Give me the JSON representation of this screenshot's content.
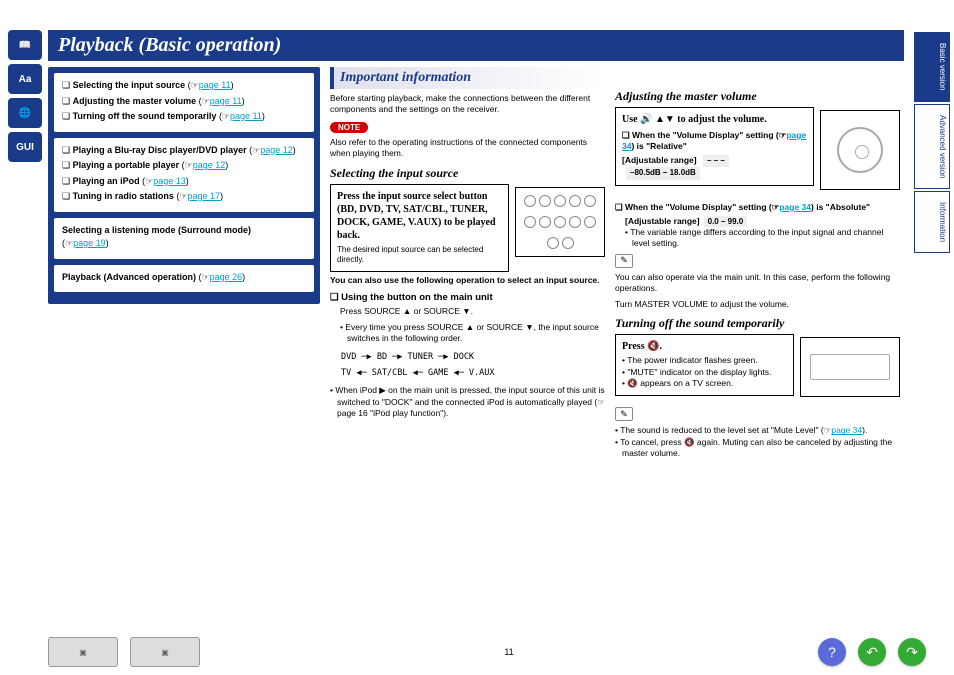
{
  "left_icons": {
    "book": "📖",
    "aa": "Aa",
    "globe": "🌐",
    "gui": "GUI"
  },
  "title": "Playback (Basic operation)",
  "toc": {
    "group1": [
      {
        "bullet": "❏",
        "label": "Selecting the input source",
        "page": "page 11"
      },
      {
        "bullet": "❏",
        "label": "Adjusting the master volume",
        "page": "page 11"
      },
      {
        "bullet": "❏",
        "label": "Turning off the sound temporarily",
        "page": "page 11"
      }
    ],
    "group2": [
      {
        "bullet": "❏",
        "label": "Playing a Blu-ray Disc player/DVD player",
        "page": "page 12"
      },
      {
        "bullet": "❏",
        "label": "Playing a portable player",
        "page": "page 12"
      },
      {
        "bullet": "❏",
        "label": "Playing an iPod",
        "page": "page 13"
      },
      {
        "bullet": "❏",
        "label": "Tuning in radio stations",
        "page": "page 17"
      }
    ],
    "group3": [
      {
        "label": "Selecting a listening mode (Surround mode)",
        "page": "page 19"
      }
    ],
    "group4": [
      {
        "label": "Playback (Advanced operation)",
        "page": "page 26"
      }
    ]
  },
  "important": {
    "heading": "Important information",
    "intro": "Before starting playback, make the connections between the different components and the settings on the receiver.",
    "note_label": "NOTE",
    "note_text": "Also refer to the operating instructions of the connected components when playing them."
  },
  "selecting": {
    "heading": "Selecting the input source",
    "callout_serif": "Press the input source select button (BD, DVD, TV, SAT/CBL, TUNER, DOCK, GAME, V.AUX) to be played back.",
    "callout_small": "The desired input source can be selected directly.",
    "after_callout": "You can also use the following operation to select an input source.",
    "using_heading": "❏ Using the button on the main unit",
    "press_line": "Press SOURCE ▲ or SOURCE ▼.",
    "press_detail": "Every time you press SOURCE ▲ or SOURCE ▼, the input source switches in the following order.",
    "flow_line1": "DVD ─▶ BD ─▶ TUNER ─▶ DOCK",
    "flow_line2": "TV ◀─ SAT/CBL ◀─ GAME ◀─ V.AUX",
    "ipod_note": "When iPod ▶ on the main unit is pressed, the input source of this unit is switched to \"DOCK\" and the connected iPod is automatically played (☞page 16 \"iPod play function\")."
  },
  "adjusting": {
    "heading": "Adjusting the master volume",
    "use_line": "Use 🔊 ▲▼ to adjust the volume.",
    "rel_heading": "❏ When the \"Volume Display\" setting (☞",
    "rel_page": "page 34",
    "rel_heading_end": ") is \"Relative\"",
    "rel_range_label": "[Adjustable range]",
    "rel_range_left": "– – –",
    "rel_range_right": "–80.5dB – 18.0dB",
    "abs_heading": "❏ When the \"Volume Display\" setting (☞",
    "abs_page": "page 34",
    "abs_heading_end": ") is \"Absolute\"",
    "abs_range_label": "[Adjustable range]",
    "abs_range": "0.0 – 99.0",
    "abs_note": "The variable range differs according to the input signal and channel level setting.",
    "main_unit_note": "You can also operate via the main unit. In this case, perform the following operations.",
    "turn_line": "Turn MASTER VOLUME to adjust the volume."
  },
  "turnoff": {
    "heading": "Turning off the sound temporarily",
    "press": "Press 🔇.",
    "b1": "The power indicator flashes green.",
    "b2": "\"MUTE\" indicator on the display lights.",
    "b3": "🔇 appears on a TV screen.",
    "n1_a": "The sound is reduced to the level set at \"Mute Level\" (☞",
    "n1_page": "page 34",
    "n1_b": ").",
    "n2": "To cancel, press 🔇 again. Muting can also be canceled by adjusting the master volume."
  },
  "right_tabs": {
    "t1": "Basic version",
    "t2": "Advanced version",
    "t3": "Information"
  },
  "footer": {
    "page": "11"
  },
  "pencil_glyph": "✎"
}
